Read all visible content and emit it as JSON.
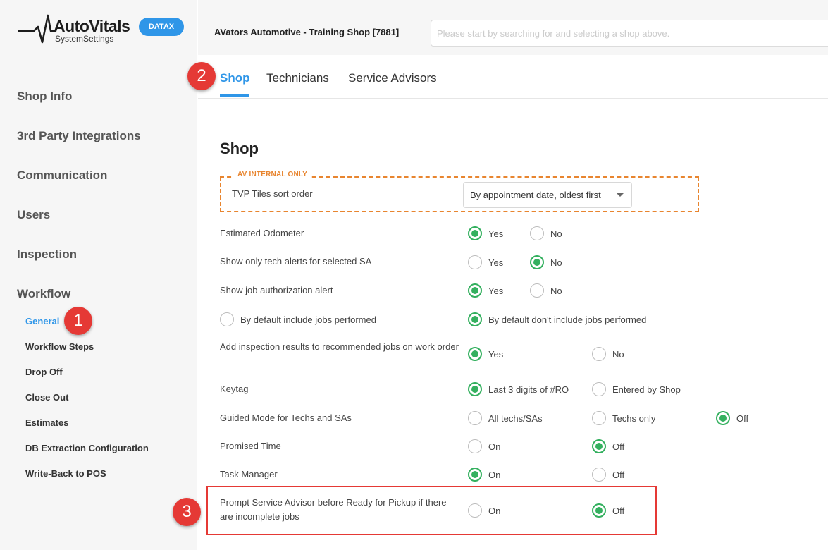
{
  "sidebar": {
    "logo_title": "AutoVitals",
    "logo_subtitle": "SystemSettings",
    "badge": "DATAX",
    "nav": [
      {
        "label": "Shop Info"
      },
      {
        "label": "3rd Party Integrations"
      },
      {
        "label": "Communication"
      },
      {
        "label": "Users"
      },
      {
        "label": "Inspection"
      },
      {
        "label": "Workflow"
      }
    ],
    "workflow_items": [
      {
        "label": "General",
        "active": true
      },
      {
        "label": "Workflow Steps"
      },
      {
        "label": "Drop Off"
      },
      {
        "label": "Close Out"
      },
      {
        "label": "Estimates"
      },
      {
        "label": "DB Extraction Configuration"
      },
      {
        "label": "Write-Back to POS"
      }
    ]
  },
  "header": {
    "shop_name": "AVators Automotive - Training Shop [7881]",
    "search_placeholder": "Please start by searching for and selecting a shop above."
  },
  "tabs": [
    {
      "label": "Shop",
      "active": true
    },
    {
      "label": "Technicians"
    },
    {
      "label": "Service Advisors"
    }
  ],
  "markers": [
    "1",
    "2",
    "3"
  ],
  "content": {
    "title": "Shop",
    "internal_label": "AV INTERNAL ONLY",
    "tvp_label": "TVP Tiles sort order",
    "tvp_value": "By appointment date, oldest first",
    "settings": [
      {
        "label": "Estimated Odometer",
        "options": [
          {
            "text": "Yes",
            "selected": true
          },
          {
            "text": "No",
            "selected": false
          }
        ]
      },
      {
        "label": "Show only tech alerts for selected SA",
        "options": [
          {
            "text": "Yes",
            "selected": false
          },
          {
            "text": "No",
            "selected": true
          }
        ]
      },
      {
        "label": "Show job authorization alert",
        "options": [
          {
            "text": "Yes",
            "selected": true
          },
          {
            "text": "No",
            "selected": false
          }
        ]
      },
      {
        "label": "",
        "options": [
          {
            "text": "By default include jobs performed",
            "selected": false
          },
          {
            "text": "By default don't include jobs performed",
            "selected": true
          }
        ]
      },
      {
        "label": "Add inspection results to recommended jobs on work order",
        "options": [
          {
            "text": "Yes",
            "selected": true
          },
          {
            "text": "No",
            "selected": false
          }
        ]
      },
      {
        "label": "Keytag",
        "options": [
          {
            "text": "Last 3 digits of #RO",
            "selected": true
          },
          {
            "text": "Entered by Shop",
            "selected": false
          }
        ]
      },
      {
        "label": "Guided Mode for Techs and SAs",
        "options": [
          {
            "text": "All techs/SAs",
            "selected": false
          },
          {
            "text": "Techs only",
            "selected": false
          },
          {
            "text": "Off",
            "selected": true
          }
        ]
      },
      {
        "label": "Promised Time",
        "options": [
          {
            "text": "On",
            "selected": false
          },
          {
            "text": "Off",
            "selected": true
          }
        ]
      },
      {
        "label": "Task Manager",
        "options": [
          {
            "text": "On",
            "selected": true
          },
          {
            "text": "Off",
            "selected": false
          }
        ]
      },
      {
        "label": "Prompt Service Advisor before Ready for Pickup if there are incomplete jobs",
        "options": [
          {
            "text": "On",
            "selected": false
          },
          {
            "text": "Off",
            "selected": true
          }
        ]
      }
    ]
  },
  "colors": {
    "accent": "#2f96e8",
    "radio_on": "#34b05f",
    "internal": "#e8852f",
    "callout": "#e53935"
  }
}
